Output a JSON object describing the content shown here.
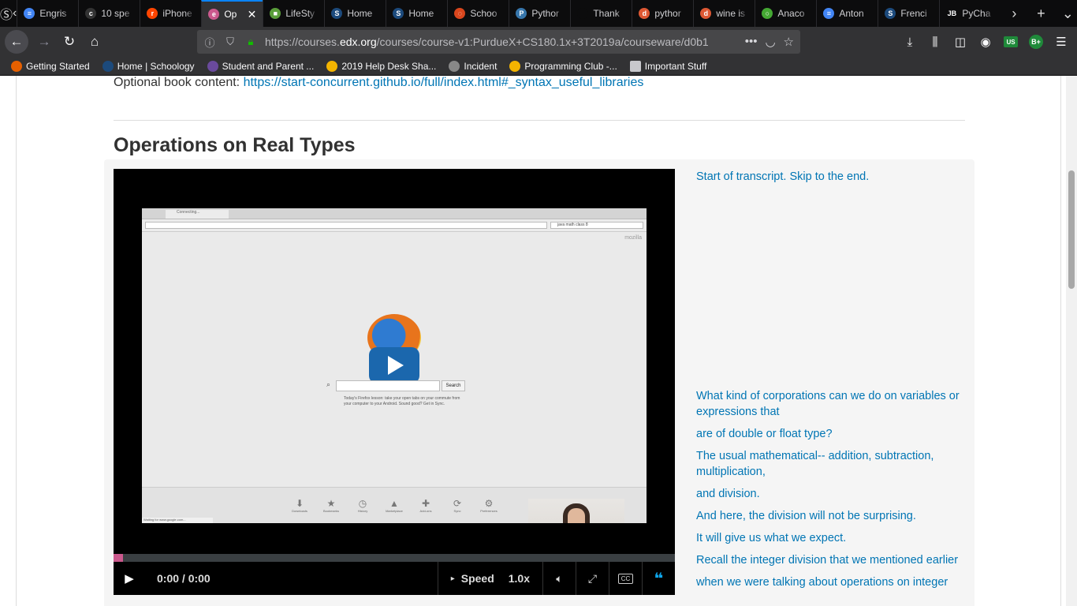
{
  "browser": {
    "tabs": [
      {
        "label": "Engris",
        "fav": "docs-icon",
        "color": "#4285f4",
        "glyph": "≡"
      },
      {
        "label": "10 spe",
        "fav": "site-icon",
        "color": "#333",
        "glyph": "c"
      },
      {
        "label": "iPhone",
        "fav": "reddit-icon",
        "color": "#ff4500",
        "glyph": "r"
      },
      {
        "label": "Op",
        "fav": "edx-icon",
        "color": "#cb598d",
        "glyph": "e",
        "active": true
      },
      {
        "label": "LifeSty",
        "fav": "image-icon",
        "color": "#5a9e3a",
        "glyph": "■"
      },
      {
        "label": "Home",
        "fav": "schoology-icon",
        "color": "#1c4a7c",
        "glyph": "S"
      },
      {
        "label": "Home",
        "fav": "schoology-icon",
        "color": "#1c4a7c",
        "glyph": "S"
      },
      {
        "label": "Schoo",
        "fav": "loading-icon",
        "color": "#d9461d",
        "glyph": "◌"
      },
      {
        "label": "Pythor",
        "fav": "python-icon",
        "color": "#3776ab",
        "glyph": "P"
      },
      {
        "label": "Thank",
        "fav": "blank-icon",
        "color": "#0c0c0d",
        "glyph": ""
      },
      {
        "label": "pythor",
        "fav": "duckduckgo-icon",
        "color": "#de5833",
        "glyph": "d"
      },
      {
        "label": "wine is",
        "fav": "duckduckgo-icon",
        "color": "#de5833",
        "glyph": "d"
      },
      {
        "label": "Anaco",
        "fav": "anaconda-icon",
        "color": "#44a833",
        "glyph": "○"
      },
      {
        "label": "Anton",
        "fav": "docs-icon",
        "color": "#4285f4",
        "glyph": "≡"
      },
      {
        "label": "Frenci",
        "fav": "schoology-icon",
        "color": "#1c4a7c",
        "glyph": "S"
      },
      {
        "label": "PyCha",
        "fav": "jetbrains-icon",
        "color": "#0c0c0d",
        "glyph": "JB"
      }
    ],
    "url_prefix": "https://courses.",
    "url_domain": "edx.org",
    "url_rest": "/courses/course-v1:PurdueX+CS180.1x+3T2019a/courseware/d0b1",
    "bookmarks": [
      {
        "label": "Getting Started",
        "icon": "firefox-icon",
        "color": "#e66000"
      },
      {
        "label": "Home | Schoology",
        "icon": "schoology-icon",
        "color": "#1c4a7c"
      },
      {
        "label": "Student and Parent ...",
        "icon": "parchment-icon",
        "color": "#6a4a9c"
      },
      {
        "label": "2019 Help Desk Sha...",
        "icon": "drive-icon",
        "color": "#f4b400"
      },
      {
        "label": "Incident",
        "icon": "globe-icon",
        "color": "#888"
      },
      {
        "label": "Programming Club -...",
        "icon": "drive-icon",
        "color": "#f4b400"
      },
      {
        "label": "Important Stuff",
        "icon": "folder-icon",
        "color": "#c8c8cc"
      }
    ],
    "profile_badge": "B+",
    "sync_badge": "US"
  },
  "content": {
    "book_label": "Optional book content: ",
    "book_link": "https://start-concurrent.github.io/full/index.html#_syntax_useful_libraries",
    "section_title": "Operations on Real Types",
    "video": {
      "time": "0:00 / 0:00",
      "speed_label": "Speed",
      "speed_value": "1.0x",
      "progress": 0.0,
      "screen_tab_title": "Connecting...",
      "screen_search_query": "java math class 8",
      "screen_mozilla": "mozilla",
      "screen_search_button": "Search",
      "screen_tip": "Today's Firefox lesson: take your open tabs on your commute from your computer to your Android. Sound good? Get in Sync.",
      "screen_status": "Waiting for www.google.com...",
      "screen_toolbar": [
        "Downloads",
        "Bookmarks",
        "History",
        "Marketplace",
        "Add-ons",
        "Sync",
        "Preferences"
      ]
    },
    "transcript": {
      "skip": "Start of transcript. Skip to the end.",
      "lines": [
        "What kind of corporations can we do on variables or expressions that",
        "are of double or float type?",
        "The usual mathematical-- addition, subtraction, multiplication,",
        "and division.",
        "And here, the division will not be surprising.",
        "It will give us what we expect.",
        "Recall the integer division that we mentioned earlier",
        "when we were talking about operations on integer"
      ]
    }
  }
}
